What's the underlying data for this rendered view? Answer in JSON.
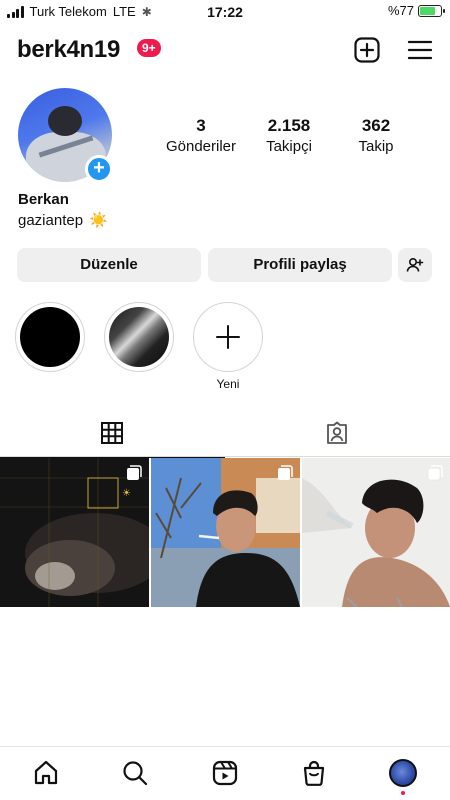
{
  "status_bar": {
    "carrier": "Turk Telekom",
    "network": "LTE",
    "time": "17:22",
    "battery_text": "%77",
    "battery_level": 0.77
  },
  "header": {
    "username": "berk4n19",
    "notification_badge": "9+",
    "add_icon": "plus-square-icon",
    "menu_icon": "hamburger-menu-icon"
  },
  "profile": {
    "stats": [
      {
        "value": "3",
        "label": "Gönderiler"
      },
      {
        "value": "2.158",
        "label": "Takipçi"
      },
      {
        "value": "362",
        "label": "Takip"
      }
    ],
    "name": "Berkan",
    "bio": "gaziantep",
    "bio_emoji": "☀️"
  },
  "actions": {
    "edit_label": "Düzenle",
    "share_label": "Profili paylaş",
    "discover_icon": "add-person-icon"
  },
  "highlights": [
    {
      "label": "",
      "style": "black"
    },
    {
      "label": "",
      "style": "fabric"
    },
    {
      "label": "Yeni",
      "style": "new"
    }
  ],
  "tabs": [
    {
      "icon": "grid-icon",
      "active": true
    },
    {
      "icon": "tagged-person-icon",
      "active": false
    }
  ],
  "posts": [
    {
      "type": "carousel"
    },
    {
      "type": "carousel"
    },
    {
      "type": "carousel"
    }
  ],
  "bottom_nav": [
    {
      "icon": "home-icon"
    },
    {
      "icon": "search-icon"
    },
    {
      "icon": "reels-icon"
    },
    {
      "icon": "shop-icon"
    },
    {
      "icon": "profile-avatar"
    }
  ],
  "colors": {
    "badge": "#ed1c4f",
    "story_add": "#2196f3",
    "button_bg": "#efefef",
    "battery_fill": "#4cd964"
  }
}
